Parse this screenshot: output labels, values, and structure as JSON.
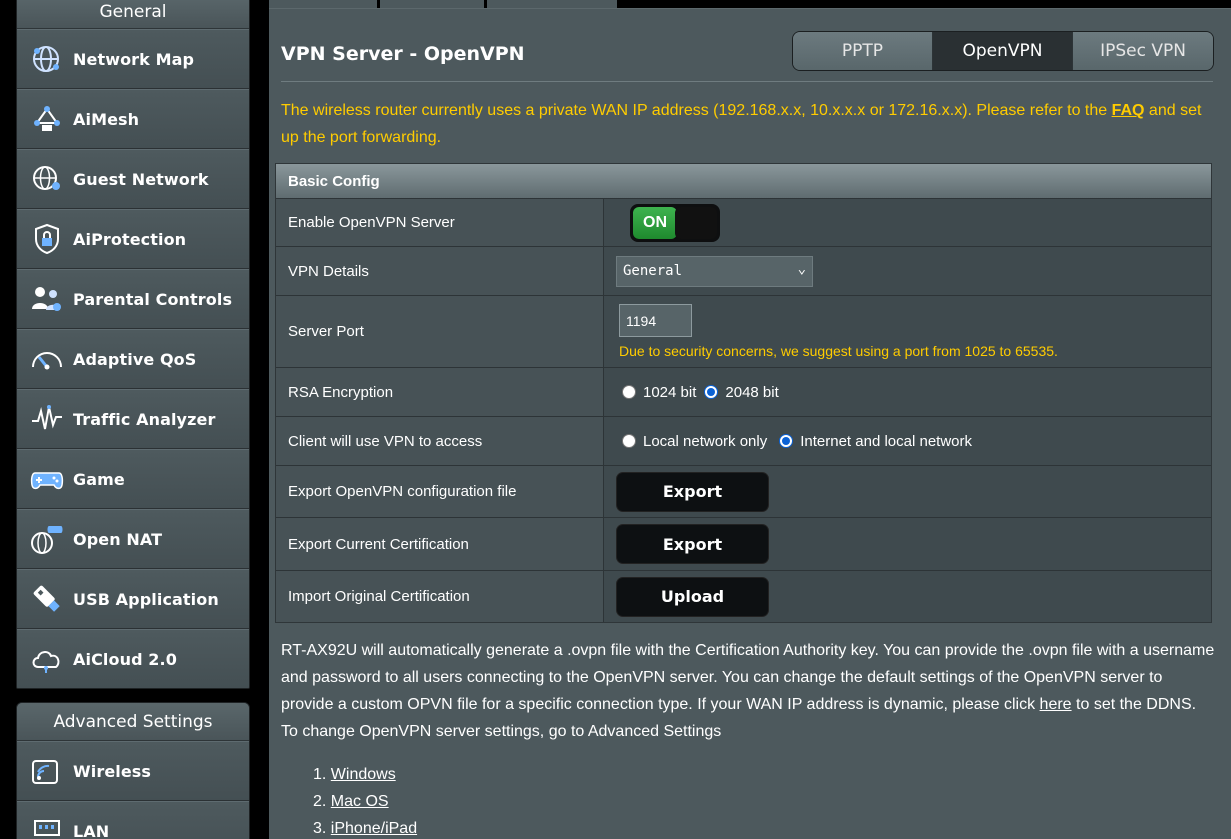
{
  "sidebar": {
    "general_header": "General",
    "general_items": [
      {
        "label": "Network Map",
        "icon": "network-map-icon"
      },
      {
        "label": "AiMesh",
        "icon": "aimesh-icon"
      },
      {
        "label": "Guest Network",
        "icon": "guest-network-icon"
      },
      {
        "label": "AiProtection",
        "icon": "aiprotection-icon"
      },
      {
        "label": "Parental Controls",
        "icon": "parental-controls-icon"
      },
      {
        "label": "Adaptive QoS",
        "icon": "adaptive-qos-icon"
      },
      {
        "label": "Traffic Analyzer",
        "icon": "traffic-analyzer-icon"
      },
      {
        "label": "Game",
        "icon": "game-icon"
      },
      {
        "label": "Open NAT",
        "icon": "open-nat-icon"
      },
      {
        "label": "USB Application",
        "icon": "usb-application-icon"
      },
      {
        "label": "AiCloud 2.0",
        "icon": "aicloud-icon"
      }
    ],
    "advanced_header": "Advanced Settings",
    "advanced_items": [
      {
        "label": "Wireless",
        "icon": "wireless-icon"
      },
      {
        "label": "LAN",
        "icon": "lan-icon"
      }
    ]
  },
  "main": {
    "title": "VPN Server - OpenVPN",
    "tabs": [
      "PPTP",
      "OpenVPN",
      "IPSec VPN"
    ],
    "active_tab": "OpenVPN",
    "notice_text": "The wireless router currently uses a private WAN IP address (192.168.x.x, 10.x.x.x or 172.16.x.x). Please refer to the ",
    "notice_link": "FAQ",
    "notice_tail": " and set up the port forwarding.",
    "config": {
      "header": "Basic Config",
      "enable_label": "Enable OpenVPN Server",
      "enable_state": "ON",
      "details_label": "VPN Details",
      "details_value": "General",
      "port_label": "Server Port",
      "port_value": "1194",
      "port_hint": "Due to security concerns, we suggest using a port from 1025 to 65535.",
      "rsa_label": "RSA Encryption",
      "rsa_options": [
        "1024 bit",
        "2048 bit"
      ],
      "rsa_selected": "2048 bit",
      "access_label": "Client will use VPN to access",
      "access_options": [
        "Local network only",
        "Internet and local network"
      ],
      "access_selected": "Internet and local network",
      "export_config_label": "Export OpenVPN configuration file",
      "export_config_button": "Export",
      "export_cert_label": "Export Current Certification",
      "export_cert_button": "Export",
      "import_cert_label": "Import Original Certification",
      "import_cert_button": "Upload"
    },
    "description_main": "RT-AX92U will automatically generate a .ovpn file with the Certification Authority key. You can provide the .ovpn file with a username and password to all users connecting to the OpenVPN server. You can change the default settings of the OpenVPN server to provide a custom OPVN file for a specific connection type. If your WAN IP address is dynamic, please click ",
    "description_link": "here",
    "description_tail": " to set the DDNS. To change OpenVPN server settings, go to Advanced Settings",
    "os_list": [
      "Windows",
      "Mac OS",
      "iPhone/iPad"
    ]
  },
  "colors": {
    "panel_bg": "#4d595d",
    "notice_yellow": "#ffcc00",
    "toggle_green": "#2ea33f",
    "radio_blue": "#0b62d6"
  }
}
